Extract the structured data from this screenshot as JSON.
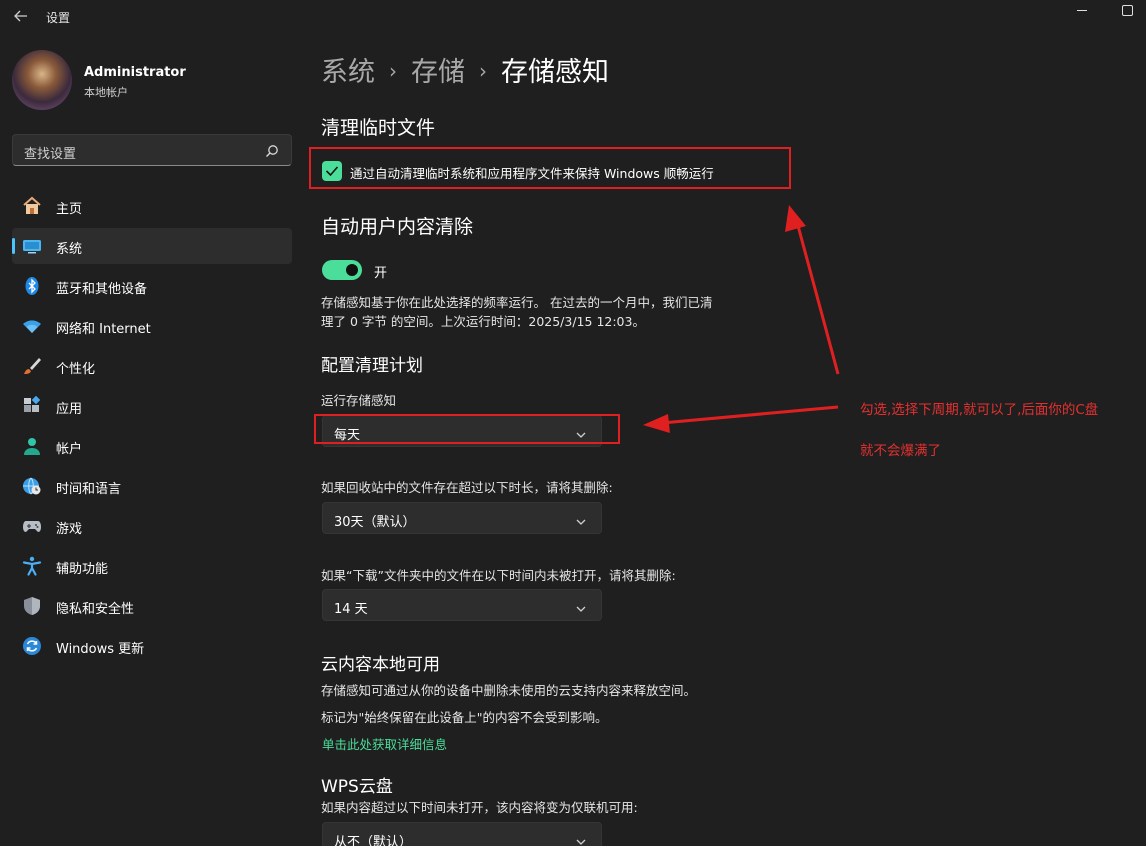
{
  "window": {
    "title": "设置"
  },
  "user": {
    "name": "Administrator",
    "account_type": "本地帐户"
  },
  "search": {
    "placeholder": "查找设置"
  },
  "nav": [
    {
      "label": "主页",
      "icon": "home-icon"
    },
    {
      "label": "系统",
      "icon": "system-icon",
      "active": true
    },
    {
      "label": "蓝牙和其他设备",
      "icon": "bluetooth-icon"
    },
    {
      "label": "网络和 Internet",
      "icon": "wifi-icon"
    },
    {
      "label": "个性化",
      "icon": "brush-icon"
    },
    {
      "label": "应用",
      "icon": "apps-icon"
    },
    {
      "label": "帐户",
      "icon": "account-icon"
    },
    {
      "label": "时间和语言",
      "icon": "globe-clock-icon"
    },
    {
      "label": "游戏",
      "icon": "gamepad-icon"
    },
    {
      "label": "辅助功能",
      "icon": "accessibility-icon"
    },
    {
      "label": "隐私和安全性",
      "icon": "shield-icon"
    },
    {
      "label": "Windows 更新",
      "icon": "update-icon"
    }
  ],
  "breadcrumb": {
    "level1": "系统",
    "level2": "存储",
    "current": "存储感知",
    "separator": "›"
  },
  "temp_files": {
    "heading": "清理临时文件",
    "checkbox_label": "通过自动清理临时系统和应用程序文件来保持 Windows 顺畅运行",
    "checked": true
  },
  "auto_cleanup": {
    "heading": "自动用户内容清除",
    "toggle_label": "开",
    "toggle_on": true,
    "desc_line1": "存储感知基于你在此处选择的频率运行。 在过去的一个月中，我们已清",
    "desc_line2": "理了 0 字节 的空间。上次运行时间：2025/3/15 12:03。"
  },
  "schedule": {
    "heading": "配置清理计划",
    "run_label": "运行存储感知",
    "run_value": "每天",
    "recycle_label": "如果回收站中的文件存在超过以下时长，请将其删除:",
    "recycle_value": "30天（默认）",
    "downloads_label": "如果“下载”文件夹中的文件在以下时间内未被打开，请将其删除:",
    "downloads_value": "14 天"
  },
  "cloud": {
    "heading": "云内容本地可用",
    "line1": "存储感知可通过从你的设备中删除未使用的云支持内容来释放空间。",
    "line2": "标记为\"始终保留在此设备上\"的内容不会受到影响。",
    "link": "单击此处获取详细信息"
  },
  "wps": {
    "heading": "WPS云盘",
    "label": "如果内容超过以下时间未打开，该内容将变为仅联机可用:",
    "value": "从不（默认）"
  },
  "annotation": {
    "line1": "勾选,选择下周期,就可以了,后面你的C盘",
    "line2": "就不会爆满了"
  },
  "colors": {
    "accent": "#4ade9a",
    "annotation_red": "#e02020",
    "background": "#1f1f1f"
  }
}
